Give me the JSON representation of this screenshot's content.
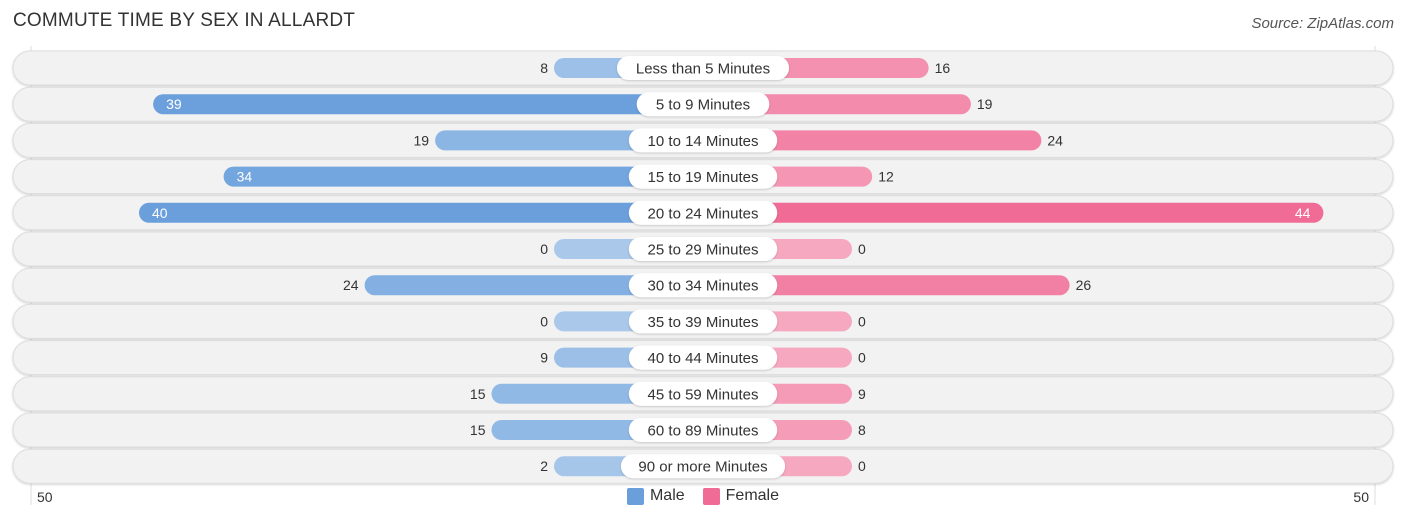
{
  "title": "COMMUTE TIME BY SEX IN ALLARDT",
  "source": "Source: ZipAtlas.com",
  "colors": {
    "male": "#6a9fdc",
    "male_light": "#a9c8ea",
    "female": "#f06b96",
    "female_light": "#f6a8c1",
    "track": "#f2f2f2"
  },
  "legend": {
    "male_label": "Male",
    "female_label": "Female"
  },
  "axis": {
    "left_label": "50",
    "right_label": "50"
  },
  "chart_data": {
    "type": "bar",
    "orientation": "horizontal-diverging",
    "title": "COMMUTE TIME BY SEX IN ALLARDT",
    "categories": [
      "Less than 5 Minutes",
      "5 to 9 Minutes",
      "10 to 14 Minutes",
      "15 to 19 Minutes",
      "20 to 24 Minutes",
      "25 to 29 Minutes",
      "30 to 34 Minutes",
      "35 to 39 Minutes",
      "40 to 44 Minutes",
      "45 to 59 Minutes",
      "60 to 89 Minutes",
      "90 or more Minutes"
    ],
    "series": [
      {
        "name": "Male",
        "values": [
          8,
          39,
          19,
          34,
          40,
          0,
          24,
          0,
          9,
          15,
          15,
          2
        ]
      },
      {
        "name": "Female",
        "values": [
          16,
          19,
          24,
          12,
          44,
          0,
          26,
          0,
          0,
          9,
          8,
          0
        ]
      }
    ],
    "xlim": [
      -50,
      50
    ],
    "xlabel": "",
    "ylabel": "",
    "legend_position": "bottom-center",
    "grid": false
  }
}
